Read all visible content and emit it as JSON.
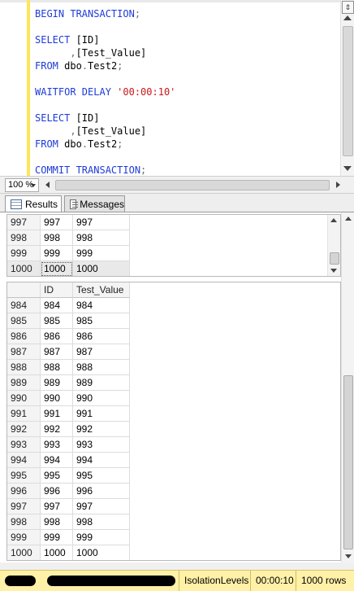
{
  "editor": {
    "lines": [
      [
        {
          "t": "BEGIN TRANSACTION",
          "c": "kw"
        },
        {
          "t": ";",
          "c": "gray"
        }
      ],
      [],
      [
        {
          "t": "SELECT ",
          "c": "kw"
        },
        {
          "t": "[ID]",
          "c": ""
        }
      ],
      [
        {
          "t": "      ,",
          "c": "gray"
        },
        {
          "t": "[Test_Value]",
          "c": ""
        }
      ],
      [
        {
          "t": "FROM ",
          "c": "kw"
        },
        {
          "t": "dbo",
          "c": ""
        },
        {
          "t": ".",
          "c": "gray"
        },
        {
          "t": "Test2",
          "c": ""
        },
        {
          "t": ";",
          "c": "gray"
        }
      ],
      [],
      [
        {
          "t": "WAITFOR DELAY ",
          "c": "kw"
        },
        {
          "t": "'00:00:10'",
          "c": "str"
        }
      ],
      [],
      [
        {
          "t": "SELECT ",
          "c": "kw"
        },
        {
          "t": "[ID]",
          "c": ""
        }
      ],
      [
        {
          "t": "      ,",
          "c": "gray"
        },
        {
          "t": "[Test_Value]",
          "c": ""
        }
      ],
      [
        {
          "t": "FROM ",
          "c": "kw"
        },
        {
          "t": "dbo",
          "c": ""
        },
        {
          "t": ".",
          "c": "gray"
        },
        {
          "t": "Test2",
          "c": ""
        },
        {
          "t": ";",
          "c": "gray"
        }
      ],
      [],
      [
        {
          "t": "COMMIT TRANSACTION",
          "c": "kw"
        },
        {
          "t": ";",
          "c": "gray"
        }
      ]
    ]
  },
  "zoom": {
    "value": "100 %"
  },
  "tabs": {
    "results_label": "Results",
    "messages_label": "Messages"
  },
  "results": {
    "grid1": {
      "rows": [
        [
          "997",
          "997",
          "997"
        ],
        [
          "998",
          "998",
          "998"
        ],
        [
          "999",
          "999",
          "999"
        ],
        [
          "1000",
          "1000",
          "1000"
        ]
      ]
    },
    "grid2": {
      "columns": [
        "",
        "ID",
        "Test_Value"
      ],
      "rows": [
        [
          "984",
          "984",
          "984"
        ],
        [
          "985",
          "985",
          "985"
        ],
        [
          "986",
          "986",
          "986"
        ],
        [
          "987",
          "987",
          "987"
        ],
        [
          "988",
          "988",
          "988"
        ],
        [
          "989",
          "989",
          "989"
        ],
        [
          "990",
          "990",
          "990"
        ],
        [
          "991",
          "991",
          "991"
        ],
        [
          "992",
          "992",
          "992"
        ],
        [
          "993",
          "993",
          "993"
        ],
        [
          "994",
          "994",
          "994"
        ],
        [
          "995",
          "995",
          "995"
        ],
        [
          "996",
          "996",
          "996"
        ],
        [
          "997",
          "997",
          "997"
        ],
        [
          "998",
          "998",
          "998"
        ],
        [
          "999",
          "999",
          "999"
        ],
        [
          "1000",
          "1000",
          "1000"
        ]
      ]
    }
  },
  "status": {
    "database": "IsolationLevels",
    "elapsed": "00:00:10",
    "rows": "1000 rows"
  },
  "colors": {
    "statusbar": "#fff1a8",
    "keyword": "#1f3bd7",
    "string": "#c8171a"
  }
}
